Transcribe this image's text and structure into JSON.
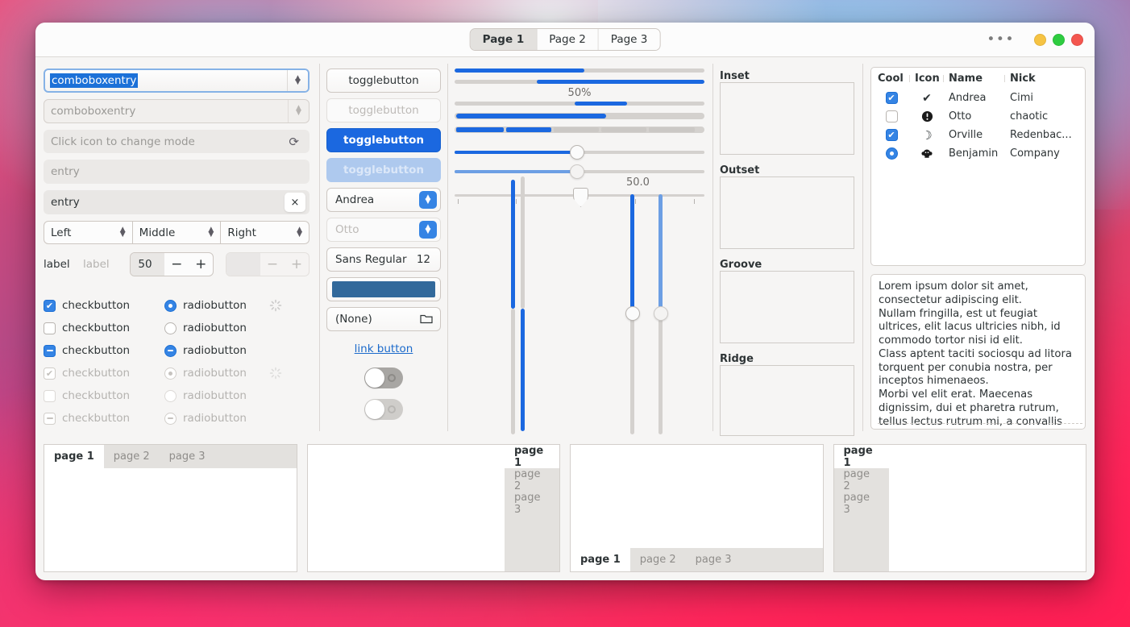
{
  "window": {
    "titlebar": {
      "tabs": [
        {
          "label": "Page 1",
          "active": true
        },
        {
          "label": "Page 2",
          "active": false
        },
        {
          "label": "Page 3",
          "active": false
        }
      ],
      "menu_button": "•••",
      "controls": [
        "minimize",
        "maximize",
        "close"
      ]
    }
  },
  "entries": {
    "comboboxentry_active": "comboboxentry",
    "comboboxentry_disabled": "comboboxentry",
    "icon_entry_placeholder": "Click icon to change mode",
    "icon_entry_icon": "refresh-icon",
    "entry_placeholder": "entry",
    "entry_value": "entry",
    "entry_clear_icon": "×",
    "combos": [
      "Left",
      "Middle",
      "Right"
    ],
    "label_enabled": "label",
    "label_disabled": "label",
    "spin_value": "50",
    "spin_minus": "−",
    "spin_plus": "+",
    "spin_disabled_value": "",
    "checkbuttons": [
      {
        "label": "checkbutton",
        "state": "checked",
        "disabled": false,
        "spinner": true
      },
      {
        "label": "checkbutton",
        "state": "unchecked",
        "disabled": false,
        "spinner": false
      },
      {
        "label": "checkbutton",
        "state": "mixed",
        "disabled": false,
        "spinner": false
      },
      {
        "label": "checkbutton",
        "state": "checked",
        "disabled": true,
        "spinner": true
      },
      {
        "label": "checkbutton",
        "state": "unchecked",
        "disabled": true,
        "spinner": false
      },
      {
        "label": "checkbutton",
        "state": "mixed",
        "disabled": true,
        "spinner": false
      }
    ],
    "radiobuttons": [
      {
        "label": "radiobutton",
        "state": "checked",
        "disabled": false
      },
      {
        "label": "radiobutton",
        "state": "unchecked",
        "disabled": false
      },
      {
        "label": "radiobutton",
        "state": "mixed",
        "disabled": false
      },
      {
        "label": "radiobutton",
        "state": "checked",
        "disabled": true
      },
      {
        "label": "radiobutton",
        "state": "unchecked",
        "disabled": true
      },
      {
        "label": "radiobutton",
        "state": "mixed",
        "disabled": true
      }
    ]
  },
  "buttons": {
    "toggle1": "togglebutton",
    "toggle2": "togglebutton",
    "toggle3": "togglebutton",
    "toggle4": "togglebutton",
    "select_name": "Andrea",
    "select_name_disabled": "Otto",
    "font_name": "Sans Regular",
    "font_size": "12",
    "color_value": "#32699b",
    "file_value": "(None)",
    "file_icon": "folder-icon",
    "link_label": "link button",
    "switch_on": "off",
    "switch_disabled": "off"
  },
  "scales": {
    "percent_label": "50%",
    "vertical_value_label": "50.0",
    "progress1_pct": 52,
    "progress2_start": 33,
    "progress2_pct": 67,
    "progress3_start": 48,
    "progress3_pct": 20,
    "level1_pct": 60,
    "level_segments": [
      {
        "start": 1,
        "width": 22,
        "color": "#1b68e0"
      },
      {
        "start": 24,
        "width": 33,
        "color": "#1b68e0"
      }
    ],
    "slider1_pct": 48,
    "slider2_pct": 48,
    "marks_slider_pct": 48,
    "accent_color": "#1b68e0",
    "trough_color": "#d4d1ce"
  },
  "frames": {
    "items": [
      {
        "title": "Inset"
      },
      {
        "title": "Outset"
      },
      {
        "title": "Groove"
      },
      {
        "title": "Ridge"
      }
    ]
  },
  "treeview": {
    "columns": [
      "Cool",
      "Icon",
      "Name",
      "Nick"
    ],
    "rows": [
      {
        "cool": "checked",
        "icon": "check-circle-icon",
        "glyph": "✔",
        "name": "Andrea",
        "nick": "Cimi"
      },
      {
        "cool": "unchecked",
        "icon": "warning-circle-icon",
        "glyph": "!",
        "name": "Otto",
        "nick": "chaotic"
      },
      {
        "cool": "checked",
        "icon": "moon-icon",
        "glyph": "☾",
        "name": "Orville",
        "nick": "Redenbac..."
      },
      {
        "cool": "radio",
        "icon": "monkey-icon",
        "glyph": "🐵",
        "name": "Benjamin",
        "nick": "Company"
      }
    ]
  },
  "textview": {
    "content": "Lorem ipsum dolor sit amet, consectetur adipiscing elit.\nNullam fringilla, est ut feugiat ultrices, elit lacus ultricies nibh, id commodo tortor nisi id elit.\nClass aptent taciti sociosqu ad litora torquent per conubia nostra, per inceptos himenaeos.\nMorbi vel elit erat. Maecenas dignissim, dui et pharetra rutrum, tellus lectus rutrum mi, a convallis libero nisi quis tellus.\nNulla facilisi. Nullam eleifend"
  },
  "notebooks": [
    {
      "position": "top",
      "tabs": [
        {
          "label": "page 1",
          "active": true
        },
        {
          "label": "page 2",
          "active": false
        },
        {
          "label": "page 3",
          "active": false
        }
      ]
    },
    {
      "position": "right",
      "tabs": [
        {
          "label": "page 1",
          "active": true
        },
        {
          "label": "page 2",
          "active": false
        },
        {
          "label": "page 3",
          "active": false
        }
      ]
    },
    {
      "position": "bottom",
      "tabs": [
        {
          "label": "page 1",
          "active": true
        },
        {
          "label": "page 2",
          "active": false
        },
        {
          "label": "page 3",
          "active": false
        }
      ]
    },
    {
      "position": "left",
      "tabs": [
        {
          "label": "page 1",
          "active": true
        },
        {
          "label": "page 2",
          "active": false
        },
        {
          "label": "page 3",
          "active": false
        }
      ]
    }
  ]
}
